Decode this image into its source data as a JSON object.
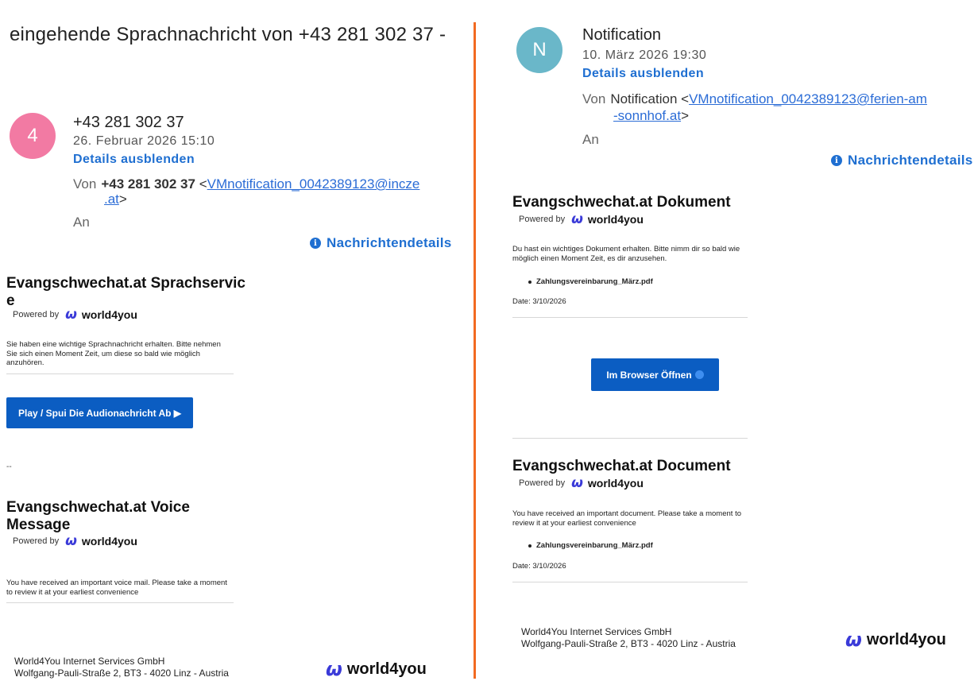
{
  "colors": {
    "divider": "#f26a21",
    "link_blue": "#1f6fd1",
    "cta_blue": "#0b5dc2",
    "avatar_left": "#f27aa3",
    "avatar_right": "#6ab7c9",
    "brand_mark": "#3a3ad8"
  },
  "left": {
    "subject": "eingehende Sprachnachricht von +43 281 302 37 -",
    "avatar_letter": "4",
    "sender_name": "+43 281 302 37",
    "sender_date": "26. Februar 2026 15:10",
    "toggle_details": "Details ausblenden",
    "from_label": "Von",
    "from_name": "+43 281 302 37",
    "from_lt": "<",
    "from_email_1": "VMnotification_0042389123@incze",
    "from_email_2": ".at",
    "from_gt": ">",
    "to_label": "An",
    "message_details": "Nachrichtendetails",
    "section1": {
      "heading_1": "Evangschwechat.at Sprachservic",
      "heading_2": "e",
      "powered_by": "Powered by",
      "brand_mark": "ω",
      "brand_word": "world4you",
      "body": "Sie haben eine wichtige Sprachnachricht erhalten. Bitte nehmen Sie sich einen Moment Zeit, um diese so bald wie möglich anzuhören.",
      "button": "Play / Spui Die Audionachricht Ab ▶"
    },
    "separator_text": "--",
    "section2": {
      "heading_1": "Evangschwechat.at Voice",
      "heading_2": "Message",
      "powered_by": "Powered by",
      "brand_mark": "ω",
      "brand_word": "world4you",
      "body": "You have received an important voice mail. Please take a moment to review it at your earliest convenience"
    },
    "footer_company": "World4You Internet Services GmbH",
    "footer_address": "Wolfgang-Pauli-Straße 2, BT3 - 4020 Linz - Austria",
    "footer_brand_mark": "ω",
    "footer_brand_word": "world4you"
  },
  "right": {
    "avatar_letter": "N",
    "sender_name": "Notification",
    "sender_date": "10. März 2026 19:30",
    "toggle_details": "Details ausblenden",
    "from_label": "Von",
    "from_name": "Notification",
    "from_lt": "<",
    "from_email_1": "VMnotification_0042389123@ferien-am",
    "from_email_2": "-sonnhof.at",
    "from_gt": ">",
    "to_label": "An",
    "message_details": "Nachrichtendetails",
    "section1": {
      "heading": "Evangschwechat.at Dokument",
      "powered_by": "Powered by",
      "brand_mark": "ω",
      "brand_word": "world4you",
      "body": "Du hast ein wichtiges Dokument erhalten. Bitte nimm dir so bald wie möglich einen Moment Zeit, es dir anzusehen.",
      "attachment": "Zahlungsvereinbarung_März.pdf",
      "date": "Date: 3/10/2026",
      "button": "Im Browser Öffnen"
    },
    "section2": {
      "heading": "Evangschwechat.at Document",
      "powered_by": "Powered by",
      "brand_mark": "ω",
      "brand_word": "world4you",
      "body": "You have received an important document. Please take a moment to review it at your earliest convenience",
      "attachment": "Zahlungsvereinbarung_März.pdf",
      "date": "Date: 3/10/2026"
    },
    "footer_company": "World4You Internet Services GmbH",
    "footer_address": "Wolfgang-Pauli-Straße 2, BT3 - 4020 Linz - Austria",
    "footer_brand_mark": "ω",
    "footer_brand_word": "world4you"
  }
}
